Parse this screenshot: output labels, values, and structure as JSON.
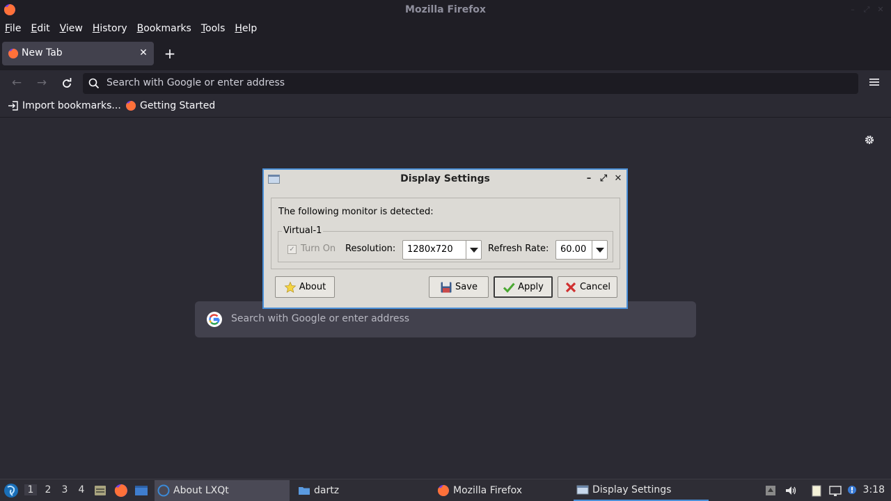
{
  "window": {
    "title": "Mozilla Firefox"
  },
  "menubar": {
    "items": [
      {
        "label": "File",
        "key": "F",
        "rest": "ile"
      },
      {
        "label": "Edit",
        "key": "E",
        "rest": "dit"
      },
      {
        "label": "View",
        "key": "V",
        "rest": "iew"
      },
      {
        "label": "History",
        "key": "H",
        "rest": "istory"
      },
      {
        "label": "Bookmarks",
        "key": "B",
        "rest": "ookmarks"
      },
      {
        "label": "Tools",
        "key": "T",
        "rest": "ools"
      },
      {
        "label": "Help",
        "key": "H",
        "rest": "elp"
      }
    ]
  },
  "tabs": [
    {
      "label": "New Tab",
      "active": true
    }
  ],
  "urlbar": {
    "placeholder": "Search with Google or enter address"
  },
  "bookmarks": [
    {
      "label": "Import bookmarks...",
      "icon": "import-icon"
    },
    {
      "label": "Getting Started",
      "icon": "firefox-icon"
    }
  ],
  "newtab": {
    "search_placeholder": "Search with Google or enter address"
  },
  "dialog": {
    "title": "Display Settings",
    "detected_text": "The following monitor is detected:",
    "monitor_name": "Virtual-1",
    "turn_on_label": "Turn On",
    "turn_on_checked": true,
    "turn_on_enabled": false,
    "resolution_label": "Resolution:",
    "resolution_value": "1280x720",
    "refresh_label": "Refresh Rate:",
    "refresh_value": "60.00",
    "buttons": {
      "about": "About",
      "save": "Save",
      "apply": "Apply",
      "cancel": "Cancel"
    }
  },
  "taskbar": {
    "workspaces": [
      "1",
      "2",
      "3",
      "4"
    ],
    "active_workspace": "1",
    "tasks": [
      {
        "label": "About LXQt",
        "icon": "lxqt-icon"
      },
      {
        "label": "dartz",
        "icon": "folder-icon"
      },
      {
        "label": "Mozilla Firefox",
        "icon": "firefox-icon"
      },
      {
        "label": "Display Settings",
        "icon": "window-icon"
      }
    ],
    "clock": "3:18"
  },
  "colors": {
    "accent": "#4a90d9",
    "firefox_dark": "#2b2a33",
    "dialog_bg": "#dcdad5"
  }
}
